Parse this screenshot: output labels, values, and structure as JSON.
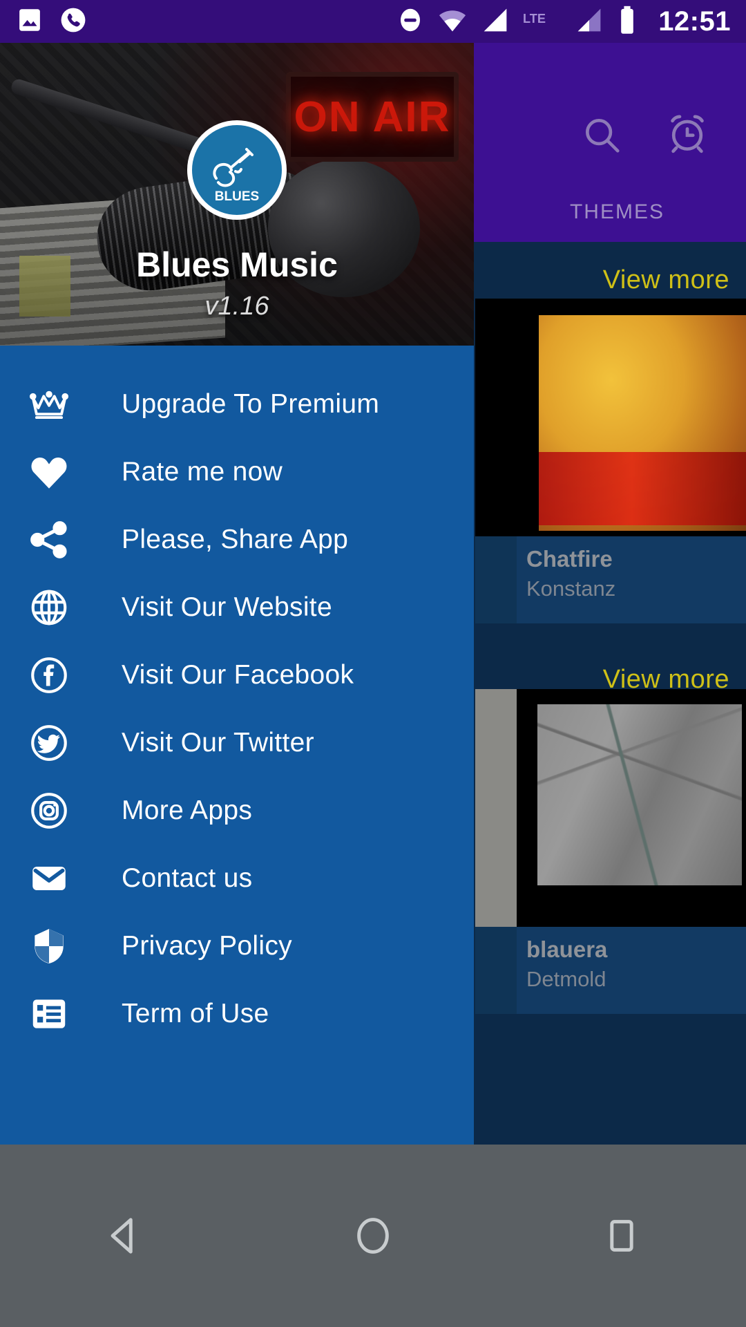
{
  "status_bar": {
    "time": "12:51",
    "left_icons": [
      "image-icon",
      "phone-call-icon"
    ],
    "right_icons": [
      "do-not-disturb-icon",
      "wifi-icon",
      "signal-icon",
      "lte-label",
      "signal-2-icon",
      "battery-icon"
    ],
    "network_label": "LTE",
    "background_color": "#340d7a"
  },
  "app_background": {
    "appbar": {
      "background_color": "#3d1092",
      "search_icon": "search-icon",
      "alarm_icon": "alarm-clock-icon",
      "tab_label": "THEMES"
    },
    "content_background_color": "#0c2948",
    "sections": [
      {
        "view_more_label": "View more",
        "cards": [
          {
            "title": "",
            "subtitle": "",
            "thumb": "gray-photo"
          },
          {
            "title": "Chatfire",
            "subtitle": "Konstanz",
            "thumb": "flame-photo"
          }
        ]
      },
      {
        "view_more_label": "View more",
        "cards": [
          {
            "title": "",
            "subtitle": "",
            "thumb": "gray-photo"
          },
          {
            "title": "blauera",
            "subtitle": "Detmold",
            "thumb": "map-photo"
          }
        ]
      }
    ],
    "link_color": "#cfc017"
  },
  "drawer": {
    "background_color": "#12599f",
    "header": {
      "logo_text": "BLUES",
      "logo_icon": "guitar-logo-icon",
      "on_air_text": "ON AIR",
      "app_title": "Blues Music",
      "app_version": "v1.16"
    },
    "items": [
      {
        "label": "Upgrade To Premium",
        "icon": "crown-icon"
      },
      {
        "label": "Rate me now",
        "icon": "heart-icon"
      },
      {
        "label": "Please, Share App",
        "icon": "share-icon"
      },
      {
        "label": "Visit Our Website",
        "icon": "globe-icon"
      },
      {
        "label": "Visit Our Facebook",
        "icon": "facebook-icon"
      },
      {
        "label": "Visit Our Twitter",
        "icon": "twitter-icon"
      },
      {
        "label": "More Apps",
        "icon": "instagram-icon"
      },
      {
        "label": "Contact us",
        "icon": "envelope-icon"
      },
      {
        "label": "Privacy Policy",
        "icon": "shield-icon"
      },
      {
        "label": "Term of Use",
        "icon": "list-document-icon"
      }
    ]
  },
  "navigation_bar": {
    "background_color": "#5a5f63",
    "buttons": [
      {
        "name": "back-button",
        "icon": "triangle-back-icon"
      },
      {
        "name": "home-button",
        "icon": "circle-home-icon"
      },
      {
        "name": "recents-button",
        "icon": "square-recents-icon"
      }
    ]
  }
}
